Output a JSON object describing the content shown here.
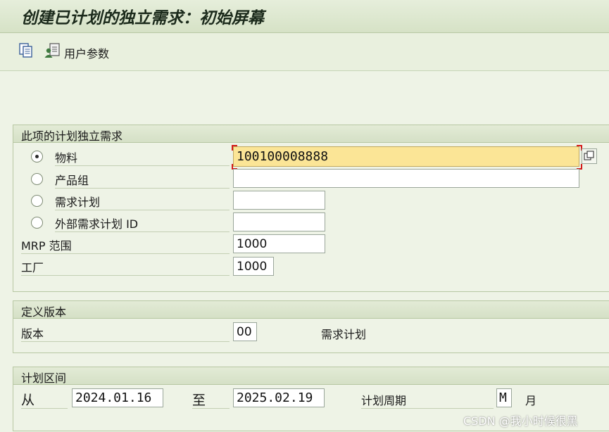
{
  "window": {
    "title": "创建已计划的独立需求：初始屏幕"
  },
  "toolbar": {
    "user_params_label": "用户参数"
  },
  "section_independent": {
    "header": "此项的计划独立需求",
    "radio_material": "物料",
    "radio_product_group": "产品组",
    "radio_req_plan": "需求计划",
    "radio_ext_req_plan": "外部需求计划 ID",
    "selected": "物料",
    "material_value": "100100008888",
    "product_group_value": "",
    "req_plan_value": "",
    "ext_req_plan_value": "",
    "mrp_label": "MRP 范围",
    "mrp_value": "1000",
    "plant_label": "工厂",
    "plant_value": "1000"
  },
  "section_version": {
    "header": "定义版本",
    "version_label": "版本",
    "version_value": "00",
    "version_desc": "需求计划"
  },
  "section_period": {
    "header": "计划区间",
    "from_label": "从",
    "from_value": "2024.01.16",
    "to_label": "至",
    "to_value": "2025.02.19",
    "period_label": "计划周期",
    "period_value": "M",
    "period_unit": "月"
  },
  "watermark": "CSDN @我小时候很黑",
  "colors": {
    "focus_field": "#fbe596",
    "panel_bg": "#eef3e6",
    "required_marker": "#d41a1a"
  }
}
